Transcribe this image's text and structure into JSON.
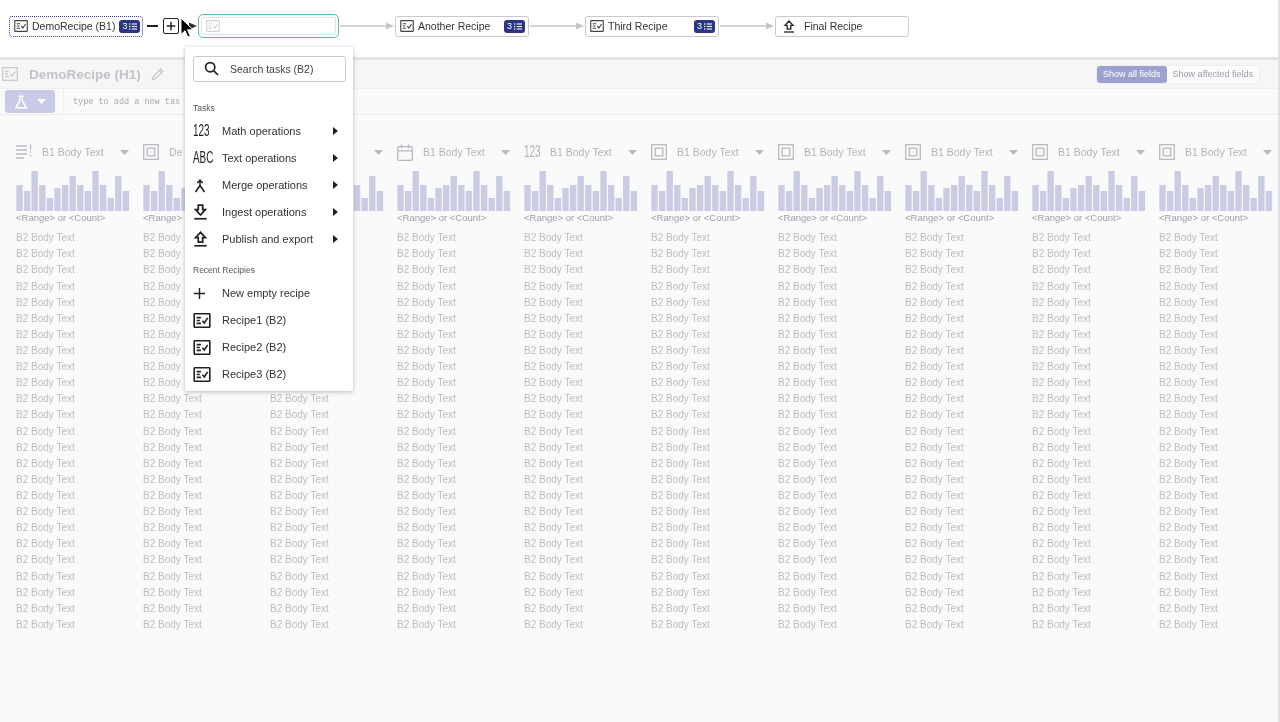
{
  "pipeline": {
    "nodes": [
      {
        "kind": "recipe",
        "label": "DemoRecipe (B1)",
        "badge": "3",
        "selected": true
      },
      {
        "kind": "placeholder",
        "selected": false
      },
      {
        "kind": "recipe",
        "label": "Another Recipe",
        "badge": "3",
        "selected": false
      },
      {
        "kind": "recipe",
        "label": "Third Recipe",
        "badge": "3",
        "selected": false
      },
      {
        "kind": "output",
        "label": "Final Recipe",
        "selected": false
      }
    ],
    "connectors": [
      {
        "kind": "insert"
      },
      {
        "kind": "arrow"
      },
      {
        "kind": "arrow"
      },
      {
        "kind": "arrow"
      }
    ]
  },
  "recipe": {
    "title": "DemoRecipe (H1)",
    "view_toggle": [
      {
        "label": "Show all fields",
        "selected": true
      },
      {
        "label": "Show affected fields",
        "selected": false
      }
    ],
    "task_input": {
      "placeholder": "type to add a new tas"
    }
  },
  "grid": {
    "columns": [
      {
        "kind": "list",
        "title": "B1 Body Text",
        "range_label": "<Range> or <Count>",
        "cells": [
          "B2 Body Text",
          "B2 Body Text",
          "B2 Body Text",
          "B2 Body Text",
          "B2 Body Text",
          "B2 Body Text",
          "B2 Body Text",
          "B2 Body Text",
          "B2 Body Text",
          "B2 Body Text",
          "B2 Body Text",
          "B2 Body Text",
          "B2 Body Text",
          "B2 Body Text",
          "B2 Body Text",
          "B2 Body Text",
          "B2 Body Text",
          "B2 Body Text",
          "B2 Body Text",
          "B2 Body Text",
          "B2 Body Text",
          "B2 Body Text",
          "B2 Body Text",
          "B2 Body Text",
          "B2 Body Text"
        ]
      },
      {
        "kind": "box",
        "title": "De",
        "range_label": "<Range>",
        "cells": [
          "B2 Body",
          "B2 Body",
          "B2 Body",
          "B2 Body",
          "B2 Body",
          "B2 Body",
          "B2 Body",
          "B2 Body",
          "B2 Body",
          "B2 Body",
          "B2 Body Text",
          "B2 Body Text",
          "B2 Body Text",
          "B2 Body Text",
          "B2 Body Text",
          "B2 Body Text",
          "B2 Body Text",
          "B2 Body Text",
          "B2 Body Text",
          "B2 Body Text",
          "B2 Body Text",
          "B2 Body Text",
          "B2 Body Text",
          "B2 Body Text",
          "B2 Body Text"
        ]
      },
      {
        "cells": [
          "B2 Body Text",
          "B2 Body Text",
          "B2 Body Text",
          "B2 Body Text",
          "B2 Body Text",
          "B2 Body Text",
          "B2 Body Text",
          "B2 Body Text",
          "B2 Body Text",
          "B2 Body Text",
          "B2 Body Text",
          "B2 Body Text",
          "B2 Body Text",
          "B2 Body Text",
          "B2 Body Text"
        ]
      },
      {
        "kind": "date",
        "title": "B1 Body Text",
        "range_label": "<Range> or <Count>",
        "cells": [
          "B2 Body Text",
          "B2 Body Text",
          "B2 Body Text",
          "B2 Body Text",
          "B2 Body Text",
          "B2 Body Text",
          "B2 Body Text",
          "B2 Body Text",
          "B2 Body Text",
          "B2 Body Text",
          "B2 Body Text",
          "B2 Body Text",
          "B2 Body Text",
          "B2 Body Text",
          "B2 Body Text",
          "B2 Body Text",
          "B2 Body Text",
          "B2 Body Text",
          "B2 Body Text",
          "B2 Body Text",
          "B2 Body Text",
          "B2 Body Text",
          "B2 Body Text",
          "B2 Body Text",
          "B2 Body Text"
        ]
      },
      {
        "kind": "number",
        "glyph": "123",
        "title": "B1 Body Text",
        "range_label": "<Range> or <Count>",
        "cells": [
          "B2 Body Text",
          "B2 Body Text",
          "B2 Body Text",
          "B2 Body Text",
          "B2 Body Text",
          "B2 Body Text",
          "B2 Body Text",
          "B2 Body Text",
          "B2 Body Text",
          "B2 Body Text",
          "B2 Body Text",
          "B2 Body Text",
          "B2 Body Text",
          "B2 Body Text",
          "B2 Body Text",
          "B2 Body Text",
          "B2 Body Text",
          "B2 Body Text",
          "B2 Body Text",
          "B2 Body Text",
          "B2 Body Text",
          "B2 Body Text",
          "B2 Body Text",
          "B2 Body Text",
          "B2 Body Text"
        ]
      },
      {
        "kind": "box",
        "title": "B1 Body Text",
        "range_label": "<Range> or <Count>",
        "cells": [
          "B2 Body Text",
          "B2 Body Text",
          "B2 Body Text",
          "B2 Body Text",
          "B2 Body Text",
          "B2 Body Text",
          "B2 Body Text",
          "B2 Body Text",
          "B2 Body Text",
          "B2 Body Text",
          "B2 Body Text",
          "B2 Body Text",
          "B2 Body Text",
          "B2 Body Text",
          "B2 Body Text",
          "B2 Body Text",
          "B2 Body Text",
          "B2 Body Text",
          "B2 Body Text",
          "B2 Body Text",
          "B2 Body Text",
          "B2 Body Text",
          "B2 Body Text",
          "B2 Body Text",
          "B2 Body Text"
        ]
      },
      {
        "kind": "box",
        "title": "B1 Body Text",
        "range_label": "<Range> or <Count>",
        "cells": [
          "B2 Body Text",
          "B2 Body Text",
          "B2 Body Text",
          "B2 Body Text",
          "B2 Body Text",
          "B2 Body Text",
          "B2 Body Text",
          "B2 Body Text",
          "B2 Body Text",
          "B2 Body Text",
          "B2 Body Text",
          "B2 Body Text",
          "B2 Body Text",
          "B2 Body Text",
          "B2 Body Text",
          "B2 Body Text",
          "B2 Body Text",
          "B2 Body Text",
          "B2 Body Text",
          "B2 Body Text",
          "B2 Body Text",
          "B2 Body Text",
          "B2 Body Text",
          "B2 Body Text",
          "B2 Body Text"
        ]
      },
      {
        "kind": "box",
        "title": "B1 Body Text",
        "range_label": "<Range> or <Count>",
        "cells": [
          "B2 Body Text",
          "B2 Body Text",
          "B2 Body Text",
          "B2 Body Text",
          "B2 Body Text",
          "B2 Body Text",
          "B2 Body Text",
          "B2 Body Text",
          "B2 Body Text",
          "B2 Body Text",
          "B2 Body Text",
          "B2 Body Text",
          "B2 Body Text",
          "B2 Body Text",
          "B2 Body Text",
          "B2 Body Text",
          "B2 Body Text",
          "B2 Body Text",
          "B2 Body Text",
          "B2 Body Text",
          "B2 Body Text",
          "B2 Body Text",
          "B2 Body Text",
          "B2 Body Text",
          "B2 Body Text"
        ]
      },
      {
        "kind": "box",
        "title": "B1 Body Text",
        "range_label": "<Range> or <Count>",
        "cells": [
          "B2 Body Text",
          "B2 Body Text",
          "B2 Body Text",
          "B2 Body Text",
          "B2 Body Text",
          "B2 Body Text",
          "B2 Body Text",
          "B2 Body Text",
          "B2 Body Text",
          "B2 Body Text",
          "B2 Body Text",
          "B2 Body Text",
          "B2 Body Text",
          "B2 Body Text",
          "B2 Body Text",
          "B2 Body Text",
          "B2 Body Text",
          "B2 Body Text",
          "B2 Body Text",
          "B2 Body Text",
          "B2 Body Text",
          "B2 Body Text",
          "B2 Body Text",
          "B2 Body Text",
          "B2 Body Text"
        ]
      },
      {
        "kind": "box",
        "title": "B1 Body Text",
        "range_label": "<Range> or <Count>",
        "cells": [
          "B2 Body Text",
          "B2 Body Text",
          "B2 Body Text",
          "B2 Body Text",
          "B2 Body Text",
          "B2 Body Text",
          "B2 Body Text",
          "B2 Body Text",
          "B2 Body Text",
          "B2 Body Text",
          "B2 Body Text",
          "B2 Body Text",
          "B2 Body Text",
          "B2 Body Text",
          "B2 Body Text",
          "B2 Body Text",
          "B2 Body Text",
          "B2 Body Text",
          "B2 Body Text",
          "B2 Body Text",
          "B2 Body Text",
          "B2 Body Text",
          "B2 Body Text",
          "B2 Body Text",
          "B2 Body Text"
        ]
      }
    ]
  },
  "task_menu": {
    "search": {
      "placeholder": "Search tasks (B2)"
    },
    "sections": [
      {
        "title": "Tasks",
        "items": [
          {
            "kind": "math",
            "glyph": "123",
            "label": "Math operations",
            "submenu": true
          },
          {
            "kind": "text",
            "glyph": "ABC",
            "label": "Text operations",
            "submenu": true
          },
          {
            "kind": "merge",
            "label": "Merge operations",
            "submenu": true
          },
          {
            "kind": "ingest",
            "label": "Ingest operations",
            "submenu": true
          },
          {
            "kind": "publish",
            "label": "Publish and export",
            "submenu": true
          }
        ]
      },
      {
        "title": "Recent Recipies",
        "items": [
          {
            "kind": "new",
            "label": "New empty recipe",
            "submenu": false
          },
          {
            "kind": "recipe",
            "label": "Recipe1 (B2)",
            "submenu": false
          },
          {
            "kind": "recipe",
            "label": "Recipe2 (B2)",
            "submenu": false
          },
          {
            "kind": "recipe",
            "label": "Recipe3 (B2)",
            "submenu": false
          }
        ]
      }
    ]
  }
}
